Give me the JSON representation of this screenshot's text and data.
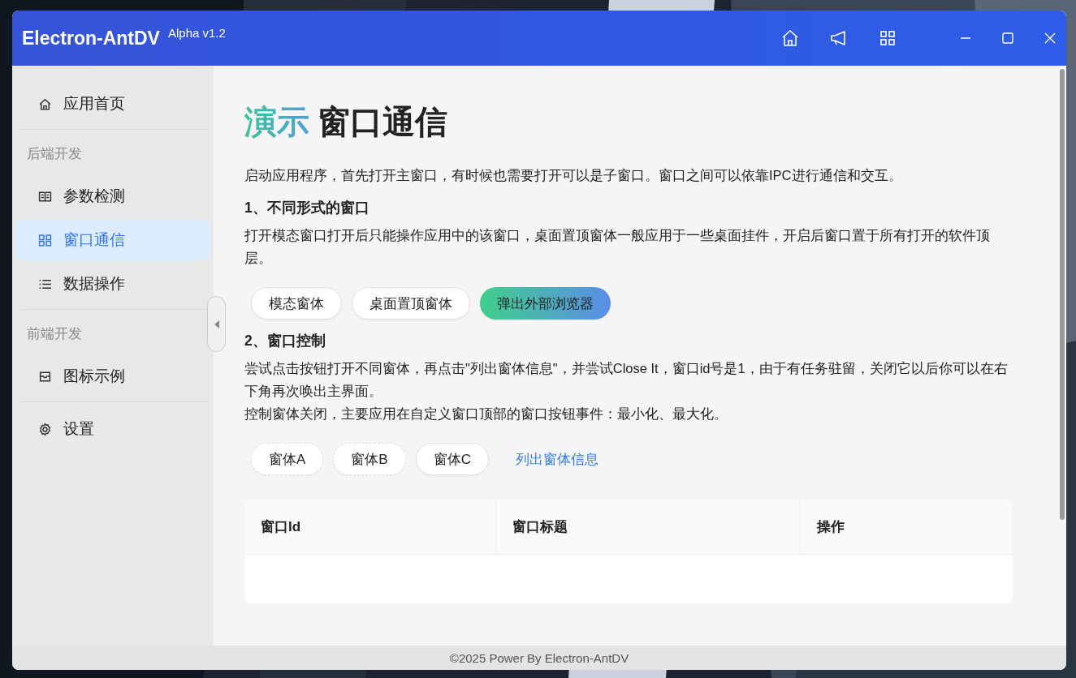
{
  "window": {
    "title": "Electron-AntDV",
    "version": "Alpha v1.2"
  },
  "sidebar": {
    "items": [
      {
        "kind": "item",
        "label": "应用首页",
        "selected": false
      },
      {
        "kind": "group",
        "label": "后端开发"
      },
      {
        "kind": "item",
        "label": "参数检测",
        "selected": false
      },
      {
        "kind": "item",
        "label": "窗口通信",
        "selected": true
      },
      {
        "kind": "item",
        "label": "数据操作",
        "selected": false
      },
      {
        "kind": "group",
        "label": "前端开发"
      },
      {
        "kind": "item",
        "label": "图标示例",
        "selected": false
      },
      {
        "kind": "item",
        "label": "设置",
        "selected": false
      }
    ]
  },
  "page": {
    "title_accent": "演示",
    "title": "窗口通信",
    "intro": "启动应用程序，首先打开主窗口，有时候也需要打开可以是子窗口。窗口之间可以依靠IPC进行通信和交互。",
    "sections": [
      {
        "heading": "1、不同形式的窗口",
        "paragraphs": [
          "打开模态窗口打开后只能操作应用中的该窗口，桌面置顶窗体一般应用于一些桌面挂件，开启后窗口置于所有打开的软件顶层。"
        ],
        "buttons": [
          {
            "kind": "default",
            "label": "模态窗体"
          },
          {
            "kind": "default",
            "label": "桌面置顶窗体"
          },
          {
            "kind": "primary",
            "label": "弹出外部浏览器"
          }
        ]
      },
      {
        "heading": "2、窗口控制",
        "paragraphs": [
          "尝试点击按钮打开不同窗体，再点击\"列出窗体信息\"，并尝试Close It，窗口id号是1，由于有任务驻留，关闭它以后你可以在右下角再次唤出主界面。",
          "控制窗体关闭，主要应用在自定义窗口顶部的窗口按钮事件：最小化、最大化。"
        ],
        "buttons": [
          {
            "kind": "dashed",
            "label": "窗体A"
          },
          {
            "kind": "dashed",
            "label": "窗体B"
          },
          {
            "kind": "default",
            "label": "窗体C"
          },
          {
            "kind": "link",
            "label": "列出窗体信息"
          }
        ]
      }
    ],
    "table": {
      "columns": [
        "窗口Id",
        "窗口标题",
        "操作"
      ]
    }
  },
  "footer": "©2025 Power By Electron-AntDV"
}
